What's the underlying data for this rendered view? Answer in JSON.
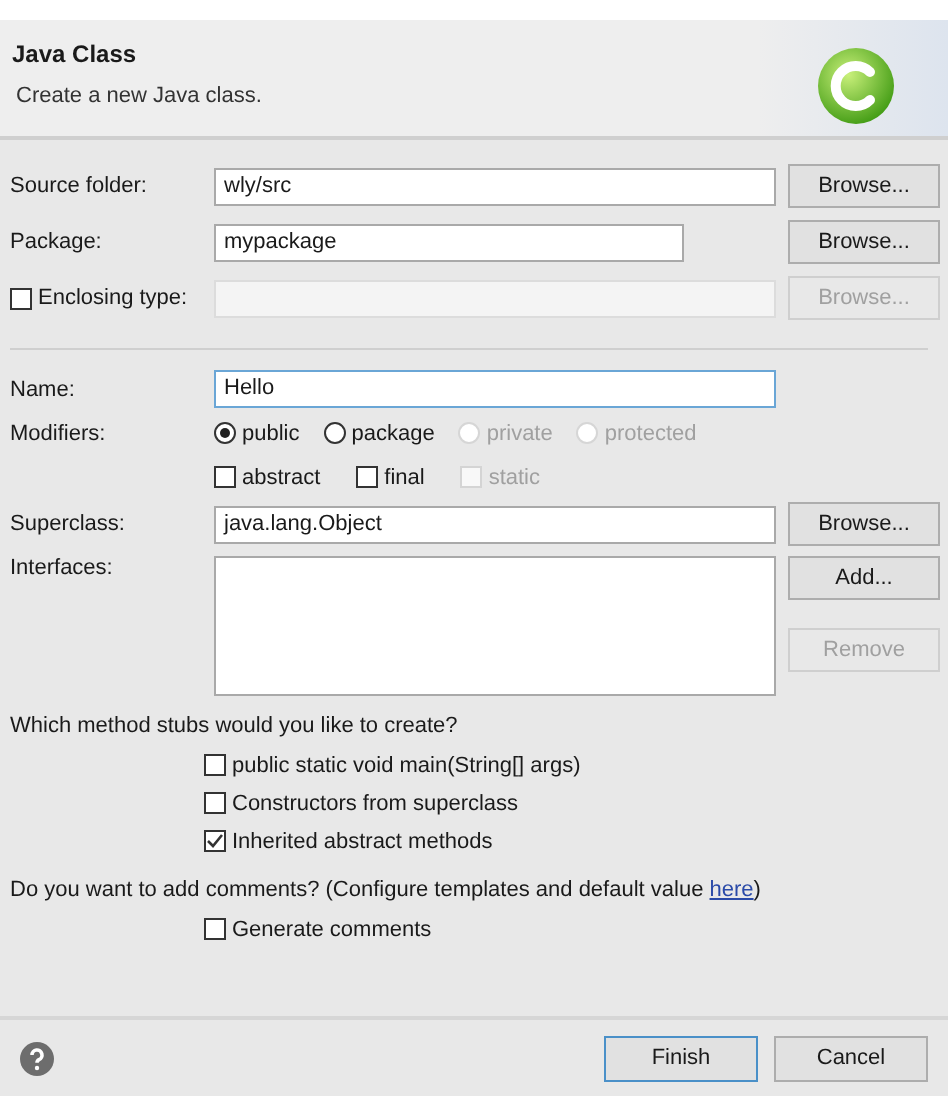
{
  "header": {
    "title": "Java Class",
    "description": "Create a new Java class."
  },
  "source_folder": {
    "label": "Source folder:",
    "value": "wly/src",
    "button": "Browse...",
    "disabled": false
  },
  "package": {
    "label": "Package:",
    "value": "mypackage",
    "button": "Browse...",
    "disabled": false
  },
  "enclosing_type": {
    "label": "Enclosing type:",
    "checked": false,
    "value_disabled": true,
    "button": "Browse...",
    "disabled": true
  },
  "name": {
    "label": "Name:",
    "value": "Hello",
    "focused": true
  },
  "modifiers": {
    "label": "Modifiers:",
    "access": [
      {
        "label": "public",
        "selected": true,
        "disabled": false
      },
      {
        "label": "package",
        "selected": false,
        "disabled": false
      },
      {
        "label": "private",
        "selected": false,
        "disabled": true
      },
      {
        "label": "protected",
        "selected": false,
        "disabled": true
      }
    ],
    "flags": [
      {
        "label": "abstract",
        "checked": false,
        "disabled": false
      },
      {
        "label": "final",
        "checked": false,
        "disabled": false
      },
      {
        "label": "static",
        "checked": false,
        "disabled": true
      }
    ]
  },
  "superclass": {
    "label": "Superclass:",
    "value": "java.lang.Object",
    "button": "Browse...",
    "disabled": false
  },
  "interfaces": {
    "label": "Interfaces:",
    "buttons": [
      {
        "label": "Add...",
        "disabled": false
      },
      {
        "label": "Remove",
        "disabled": true
      }
    ]
  },
  "method_stubs": {
    "question": "Which method stubs would you like to create?",
    "options": [
      {
        "label": "public static void main(String[] args)",
        "checked": false
      },
      {
        "label": "Constructors from superclass",
        "checked": false
      },
      {
        "label": "Inherited abstract methods",
        "checked": true
      }
    ]
  },
  "comments": {
    "question": "Do you want to add comments? (Configure templates and default value ",
    "link": "here",
    "suffix": ")",
    "options": [
      {
        "label": "Generate comments",
        "checked": false
      }
    ]
  },
  "footer": {
    "buttons": [
      {
        "label": "Finish",
        "default": true
      },
      {
        "label": "Cancel",
        "default": false
      }
    ]
  }
}
